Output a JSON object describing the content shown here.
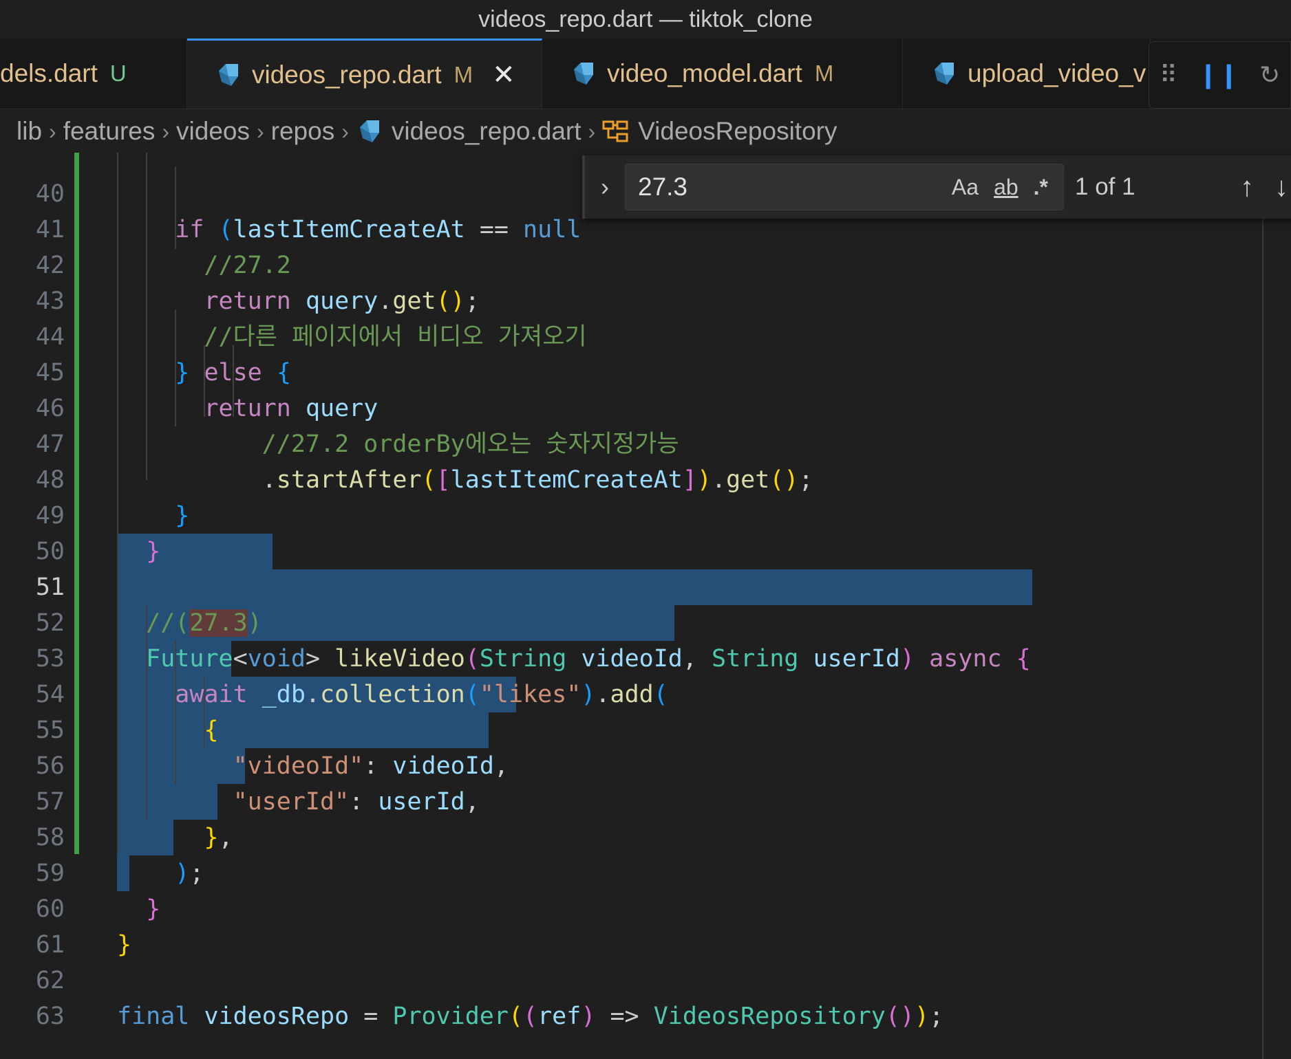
{
  "window": {
    "title": "videos_repo.dart — tiktok_clone"
  },
  "tabs": [
    {
      "label": "dels.dart",
      "status": "U"
    },
    {
      "label": "videos_repo.dart",
      "status": "M",
      "active": true
    },
    {
      "label": "video_model.dart",
      "status": "M"
    },
    {
      "label": "upload_video_v",
      "status": ""
    }
  ],
  "tab_actions": {
    "more_icon": "⠿",
    "pause_icon": "❙❙",
    "restart_icon": "↻"
  },
  "breadcrumb": [
    "lib",
    "features",
    "videos",
    "repos",
    "videos_repo.dart",
    "VideosRepository"
  ],
  "find": {
    "value": "27.3",
    "match_case": "Aa",
    "whole_word": "ab",
    "regex": ".*",
    "count": "1 of 1",
    "toggle_icon": "›",
    "prev_icon": "↑",
    "next_icon": "↓"
  },
  "lines": [
    {
      "n": "40",
      "text": "    if (lastItemCreateAt == null"
    },
    {
      "n": "41",
      "text": "      //27.2"
    },
    {
      "n": "42",
      "text": "      return query.get();"
    },
    {
      "n": "43",
      "text": "      //다른 페이지에서 비디오 가져오기"
    },
    {
      "n": "44",
      "text": "    } else {"
    },
    {
      "n": "45",
      "text": "      return query"
    },
    {
      "n": "46",
      "text": "          //27.2 orderBy에오는 숫자지정가능"
    },
    {
      "n": "47",
      "text": "          .startAfter([lastItemCreateAt]).get();"
    },
    {
      "n": "48",
      "text": "    }"
    },
    {
      "n": "49",
      "text": "  }"
    },
    {
      "n": "50",
      "text": ""
    },
    {
      "n": "51",
      "text": "  //(27.3)"
    },
    {
      "n": "52",
      "text": "  Future<void> likeVideo(String videoId, String userId) async {"
    },
    {
      "n": "53",
      "text": "    await _db.collection(\"likes\").add("
    },
    {
      "n": "54",
      "text": "      {"
    },
    {
      "n": "55",
      "text": "        \"videoId\": videoId,"
    },
    {
      "n": "56",
      "text": "        \"userId\": userId,"
    },
    {
      "n": "57",
      "text": "      },"
    },
    {
      "n": "58",
      "text": "    );"
    },
    {
      "n": "59",
      "text": "  }"
    },
    {
      "n": "60",
      "text": "}"
    },
    {
      "n": "61",
      "text": ""
    },
    {
      "n": "62",
      "text": "final videosRepo = Provider((ref) => VideosRepository());"
    },
    {
      "n": "63",
      "text": ""
    }
  ],
  "colors": {
    "background": "#1f1f1f",
    "selection": "#264f78",
    "git_modified": "#3fa14a",
    "comment": "#6a9955",
    "keyword": "#569cd6",
    "control": "#c586c0",
    "function": "#dcdcaa",
    "variable": "#9cdcfe",
    "type": "#4ec9b0",
    "string": "#ce9178",
    "modified_status": "#e2c08d"
  }
}
